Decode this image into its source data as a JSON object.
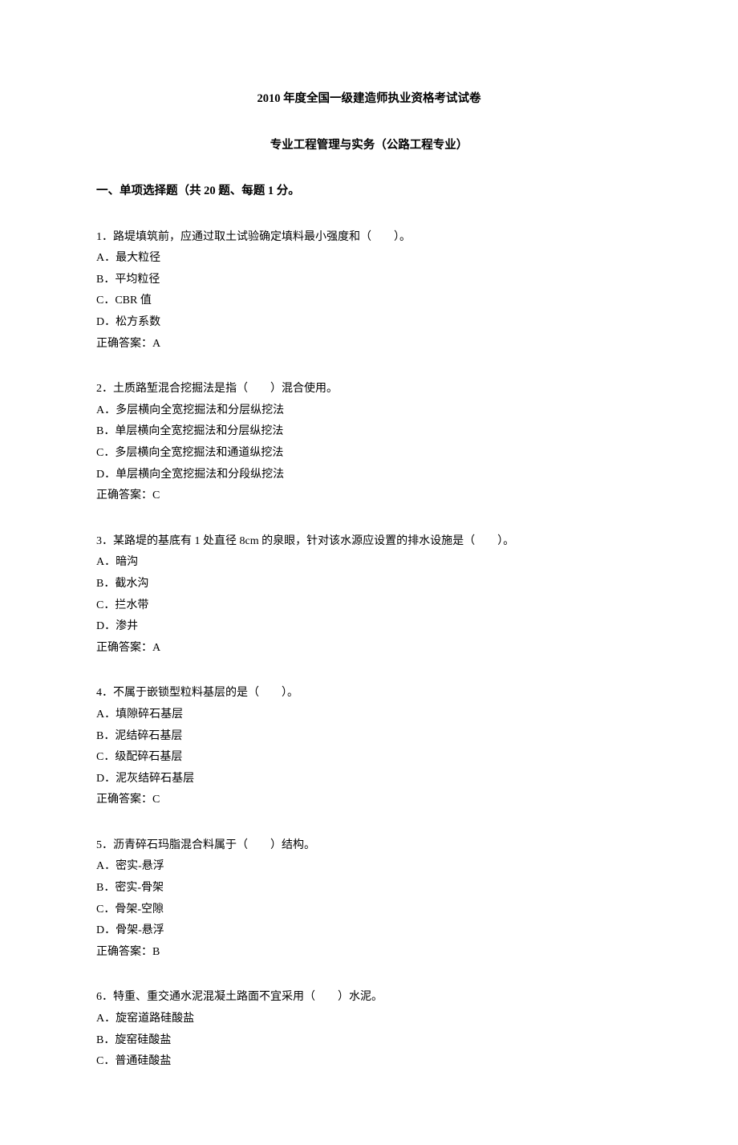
{
  "title_main": "2010 年度全国一级建造师执业资格考试试卷",
  "title_sub": "专业工程管理与实务（公路工程专业）",
  "section_header": "一、单项选择题（共 20 题、每题 1 分。",
  "answer_label": "正确答案：",
  "questions": [
    {
      "num": "1",
      "stem": "1．路堤填筑前，应通过取土试验确定填料最小强度和（　　）。",
      "options": {
        "A": "A．最大粒径",
        "B": "B．平均粒径",
        "C": "C．CBR 值",
        "D": "D．松方系数"
      },
      "answer": "A"
    },
    {
      "num": "2",
      "stem": "2．土质路堑混合挖掘法是指（　　）混合使用。",
      "options": {
        "A": "A．多层横向全宽挖掘法和分层纵挖法",
        "B": "B．单层横向全宽挖掘法和分层纵挖法",
        "C": "C．多层横向全宽挖掘法和通道纵挖法",
        "D": "D．单层横向全宽挖掘法和分段纵挖法"
      },
      "answer": "C"
    },
    {
      "num": "3",
      "stem": "3．某路堤的基底有 1 处直径 8cm 的泉眼，针对该水源应设置的排水设施是（　　）。",
      "options": {
        "A": "A．暗沟",
        "B": "B．截水沟",
        "C": "C．拦水带",
        "D": "D．渗井"
      },
      "answer": "A"
    },
    {
      "num": "4",
      "stem": "4．不属于嵌锁型粒料基层的是（　　）。",
      "options": {
        "A": "A．填隙碎石基层",
        "B": "B．泥结碎石基层",
        "C": "C．级配碎石基层",
        "D": "D．泥灰结碎石基层"
      },
      "answer": "C"
    },
    {
      "num": "5",
      "stem": "5．沥青碎石玛脂混合料属于（　　）结构。",
      "options": {
        "A": "A．密实-悬浮",
        "B": "B．密实-骨架",
        "C": "C．骨架-空隙",
        "D": "D．骨架-悬浮"
      },
      "answer": "B"
    },
    {
      "num": "6",
      "stem": "6．特重、重交通水泥混凝土路面不宜采用（　　）水泥。",
      "options": {
        "A": "A．旋窑道路硅酸盐",
        "B": "B．旋窑硅酸盐",
        "C": "C．普通硅酸盐"
      },
      "answer": ""
    }
  ]
}
